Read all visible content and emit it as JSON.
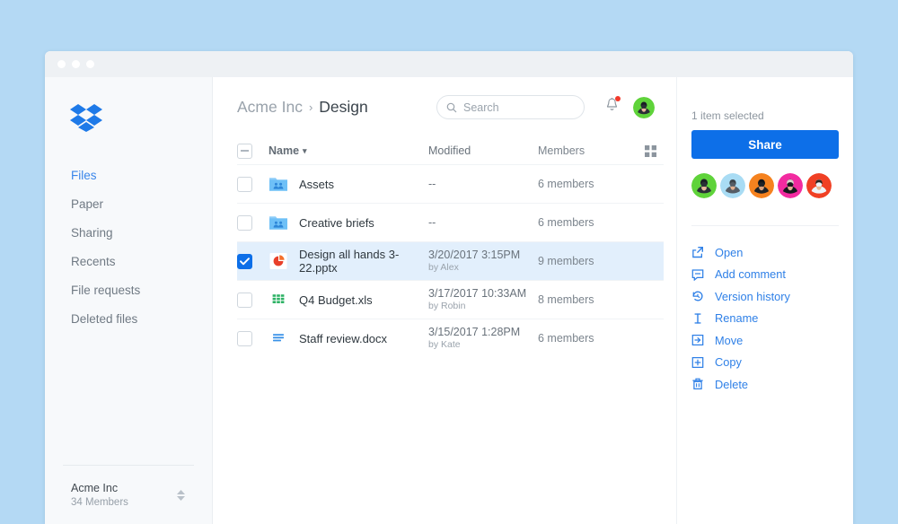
{
  "page": {
    "background_color": "#b4d9f4"
  },
  "window": {
    "titlebar_color": "#eef1f4",
    "dots": [
      "close-dot",
      "minimize-dot",
      "maximize-dot"
    ]
  },
  "sidebar": {
    "logo_icon": "dropbox-logo",
    "accent_color": "#3a86ea",
    "items": [
      {
        "label": "Files",
        "active": true
      },
      {
        "label": "Paper",
        "active": false
      },
      {
        "label": "Sharing",
        "active": false
      },
      {
        "label": "Recents",
        "active": false
      },
      {
        "label": "File requests",
        "active": false
      },
      {
        "label": "Deleted files",
        "active": false
      }
    ],
    "account": {
      "name": "Acme Inc",
      "members": "34 Members",
      "stepper_icon": "chevron-up-down-icon"
    }
  },
  "topbar": {
    "breadcrumb": {
      "root": "Acme Inc",
      "separator": "›",
      "current": "Design"
    },
    "search": {
      "placeholder": "Search",
      "value": "",
      "icon": "search-icon"
    },
    "notifications": {
      "icon": "bell-icon",
      "has_badge": true,
      "badge_color": "#f2392b"
    },
    "user_avatar": {
      "icon": "avatar",
      "background_color": "#5fd33a"
    }
  },
  "table": {
    "header": {
      "select_all_state": "indeterminate",
      "name": "Name",
      "sort_caret": "▾",
      "modified": "Modified",
      "members": "Members",
      "view_toggle_icon": "grid-view-icon"
    },
    "rows": [
      {
        "name": "Assets",
        "icon": "shared-folder-icon",
        "modified": "--",
        "modified_by": "",
        "members": "6 members",
        "selected": false
      },
      {
        "name": "Creative briefs",
        "icon": "shared-folder-icon",
        "modified": "--",
        "modified_by": "",
        "members": "6 members",
        "selected": false
      },
      {
        "name": "Design all hands 3-22.pptx",
        "icon": "powerpoint-file-icon",
        "modified": "3/20/2017 3:15PM",
        "modified_by": "by Alex",
        "members": "9 members",
        "selected": true
      },
      {
        "name": "Q4 Budget.xls",
        "icon": "excel-file-icon",
        "modified": "3/17/2017 10:33AM",
        "modified_by": "by Robin",
        "members": "8 members",
        "selected": false
      },
      {
        "name": "Staff review.docx",
        "icon": "word-file-icon",
        "modified": "3/15/2017 1:28PM",
        "modified_by": "by Kate",
        "members": "6 members",
        "selected": false
      }
    ]
  },
  "panel": {
    "selection_status": "1 item selected",
    "share_label": "Share",
    "share_color": "#0d6fe8",
    "member_avatars": [
      {
        "name": "member-avatar-1",
        "background_color": "#5fd33a"
      },
      {
        "name": "member-avatar-2",
        "background_color": "#a9dcf4"
      },
      {
        "name": "member-avatar-3",
        "background_color": "#f5821f"
      },
      {
        "name": "member-avatar-4",
        "background_color": "#f22ba0"
      },
      {
        "name": "member-avatar-5",
        "background_color": "#f04024"
      }
    ],
    "actions": [
      {
        "label": "Open",
        "icon": "external-link-icon"
      },
      {
        "label": "Add comment",
        "icon": "comment-icon"
      },
      {
        "label": "Version history",
        "icon": "history-icon"
      },
      {
        "label": "Rename",
        "icon": "text-cursor-icon"
      },
      {
        "label": "Move",
        "icon": "move-icon"
      },
      {
        "label": "Copy",
        "icon": "copy-icon"
      },
      {
        "label": "Delete",
        "icon": "trash-icon"
      }
    ],
    "action_color": "#2f80e7"
  }
}
